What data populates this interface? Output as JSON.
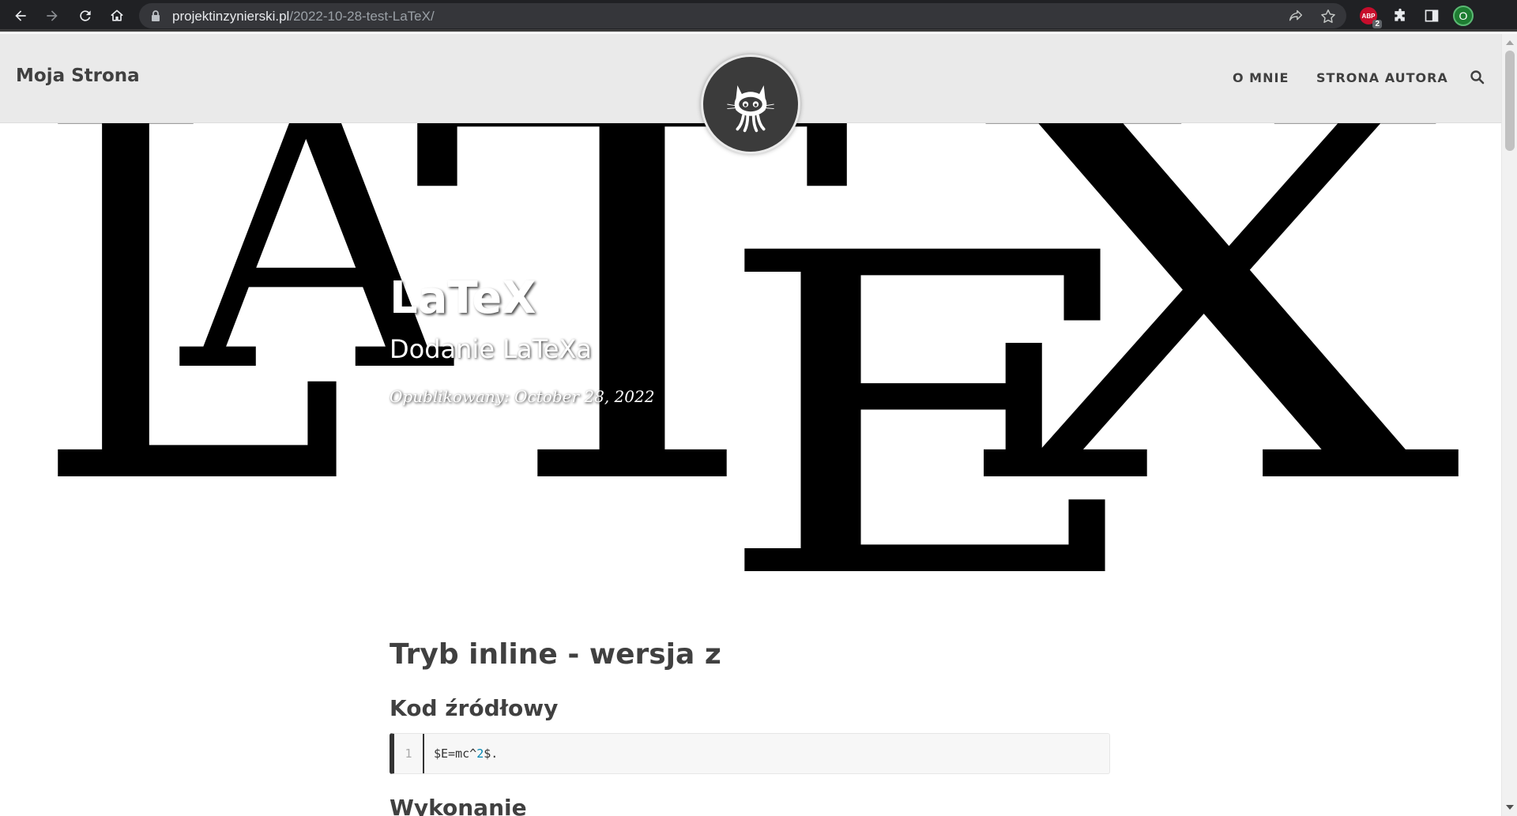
{
  "browser": {
    "url_host": "projektinzynierski.pl",
    "url_path": "/2022-10-28-test-LaTeX/",
    "extension_abp_label": "ABP",
    "extension_abp_count": "2",
    "profile_initial": "O"
  },
  "site": {
    "brand": "Moja Strona",
    "nav": [
      "O MNIE",
      "STRONA AUTORA"
    ]
  },
  "hero": {
    "background_text": "LATEX",
    "title": "LaTeX",
    "subtitle": "Dodanie LaTeXa",
    "meta": "Opublikowany: October 28, 2022"
  },
  "article": {
    "heading1": "Tryb inline - wersja z",
    "heading_source": "Kod źródłowy",
    "code_line_number": "1",
    "code_prefix": "$E=mc^",
    "code_number": "2",
    "code_suffix": "$.",
    "heading_result": "Wykonanie"
  }
}
